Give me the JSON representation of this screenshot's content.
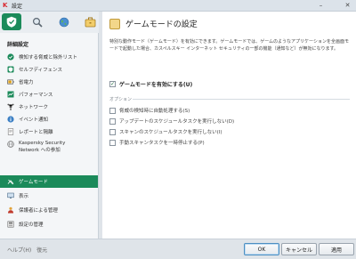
{
  "window": {
    "title": "設定",
    "logo": "K",
    "minimize": "–",
    "close": "✕"
  },
  "toolbar": {
    "buttons": [
      {
        "icon": "shield-check-icon",
        "active": true
      },
      {
        "icon": "magnifier-icon",
        "active": false
      },
      {
        "icon": "globe-icon",
        "active": false
      },
      {
        "icon": "briefcase-icon",
        "active": false
      }
    ]
  },
  "sidebar": {
    "heading": "詳細設定",
    "items": [
      {
        "label": "検知する脅威と除外リスト",
        "icon": "green-circle-icon"
      },
      {
        "label": "セルフディフェンス",
        "icon": "self-defense-icon"
      },
      {
        "label": "省電力",
        "icon": "battery-icon"
      },
      {
        "label": "パフォーマンス",
        "icon": "performance-icon"
      },
      {
        "label": "ネットワーク",
        "icon": "network-icon"
      },
      {
        "label": "イベント通知",
        "icon": "info-icon"
      },
      {
        "label": "レポートと隔離",
        "icon": "report-icon"
      },
      {
        "label_line1": "Kaspersky Security",
        "label_line2": "Network への参加",
        "icon": "ksn-icon"
      },
      {
        "label": "ゲームモード",
        "icon": "gamepad-icon",
        "selected": true
      },
      {
        "label": "表示",
        "icon": "display-icon"
      },
      {
        "label": "保護者による管理",
        "icon": "parental-icon"
      },
      {
        "label": "設定の管理",
        "icon": "settings-manage-icon"
      }
    ]
  },
  "content": {
    "title": "ゲームモードの設定",
    "description": "特別な動作モード（ゲームモード）を有効にできます。ゲームモードでは、ゲームのようなアプリケーションを全画面モードで起動した場合、カスペルスキー インターネット セキュリティの一部の機能（通知など）が無効になります。",
    "enable_checkbox": {
      "label": "ゲームモードを有効にする(U)",
      "checked": true
    },
    "options_label": "オプション",
    "options": [
      {
        "label": "脅威の検知時に自動処理する(S)",
        "checked": false
      },
      {
        "label": "アップデートのスケジュールタスクを実行しない(D)",
        "checked": false
      },
      {
        "label": "スキャンのスケジュールタスクを実行しない(I)",
        "checked": false
      },
      {
        "label": "手動スキャンタスクを一時停止する(P)",
        "checked": false
      }
    ]
  },
  "footer": {
    "help": "ヘルプ(H)",
    "restore": "復元",
    "ok": "OK",
    "cancel": "キャンセル",
    "apply": "適用"
  },
  "colors": {
    "accent_green": "#1b8a5a",
    "brand_red": "#d9272e"
  }
}
